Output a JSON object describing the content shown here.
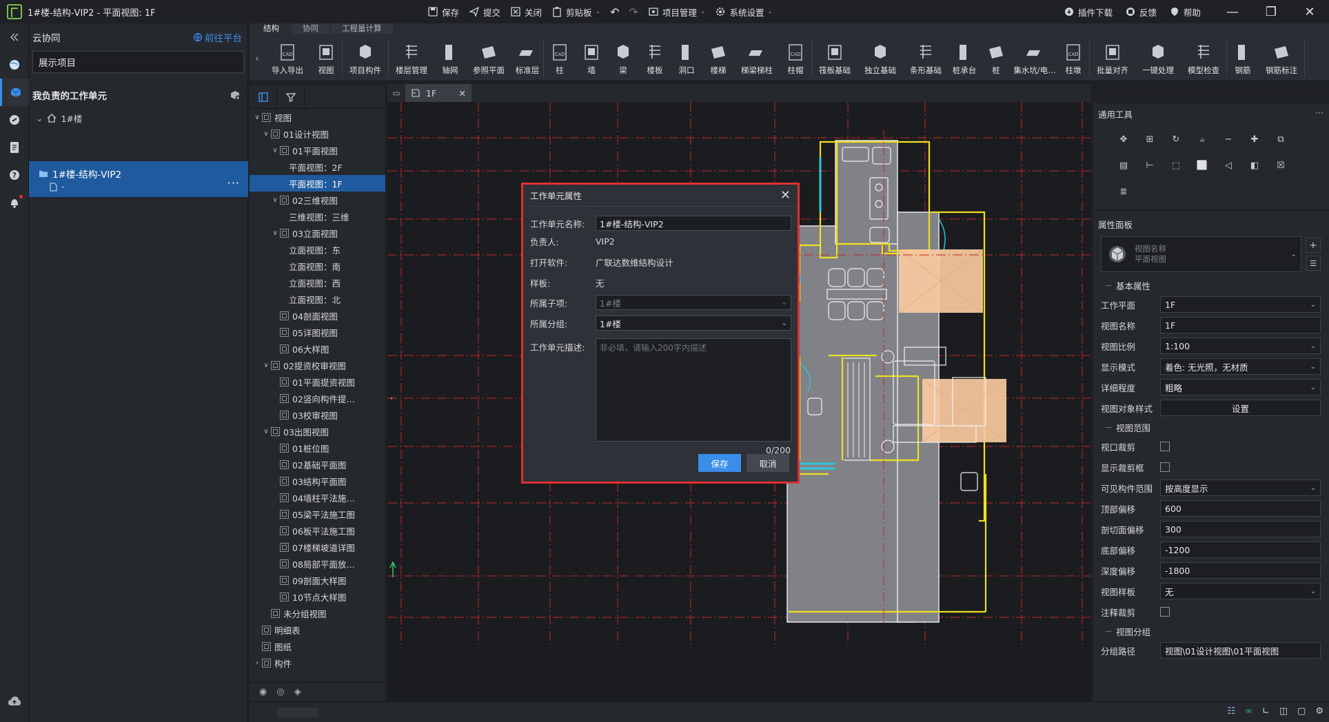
{
  "window": {
    "title": "1#楼-结构-VIP2 - 平面视图: 1F",
    "center_actions": [
      {
        "label": "保存",
        "icon": "save-icon"
      },
      {
        "label": "提交",
        "icon": "submit-icon"
      },
      {
        "label": "关闭",
        "icon": "close-doc-icon"
      },
      {
        "label": "剪贴板",
        "icon": "clipboard-icon"
      },
      {
        "label": "项目管理",
        "icon": "project-manage-icon"
      },
      {
        "label": "系统设置",
        "icon": "gear-icon"
      }
    ],
    "right_actions": [
      {
        "label": "插件下载",
        "icon": "plugin-icon"
      },
      {
        "label": "反馈",
        "icon": "feedback-icon"
      },
      {
        "label": "帮助",
        "icon": "help-icon"
      }
    ]
  },
  "left_panel": {
    "title": "云协同",
    "goto_platform": "前往平台",
    "project": "展示项目",
    "section_title": "我负责的工作单元",
    "building": "1#楼",
    "selected_unit": {
      "name": "1#楼-结构-VIP2",
      "sub": "-"
    }
  },
  "ribbon": {
    "tabs": [
      "结构",
      "协同",
      "工程量计算"
    ],
    "tools": [
      [
        "导入导出",
        "视图"
      ],
      [
        "项目构件"
      ],
      [
        "楼层管理",
        "轴网",
        "参照平面",
        "标准层"
      ],
      [
        "柱",
        "墙",
        "梁",
        "楼板",
        "洞口",
        "楼梯",
        "梯梁梯柱",
        "柱帽"
      ],
      [
        "筏板基础",
        "独立基础",
        "条形基础",
        "桩承台",
        "桩",
        "集水坑/电…",
        "柱墩"
      ],
      [
        "批量对齐",
        "一键处理",
        "模型检查"
      ],
      [
        "钢筋",
        "钢筋标注"
      ]
    ]
  },
  "tree": {
    "items": [
      {
        "label": "视图",
        "level": 0,
        "exp": "v"
      },
      {
        "label": "01设计视图",
        "level": 1,
        "exp": "v"
      },
      {
        "label": "01平面视图",
        "level": 2,
        "exp": "v"
      },
      {
        "label": "平面视图：2F",
        "level": 3,
        "exp": "",
        "nobox": true
      },
      {
        "label": "平面视图：1F",
        "level": 3,
        "exp": "",
        "nobox": true,
        "sel": true
      },
      {
        "label": "02三维视图",
        "level": 2,
        "exp": "v"
      },
      {
        "label": "三维视图：三维",
        "level": 3,
        "exp": "",
        "nobox": true
      },
      {
        "label": "03立面视图",
        "level": 2,
        "exp": "v"
      },
      {
        "label": "立面视图：东",
        "level": 3,
        "exp": "",
        "nobox": true
      },
      {
        "label": "立面视图：南",
        "level": 3,
        "exp": "",
        "nobox": true
      },
      {
        "label": "立面视图：西",
        "level": 3,
        "exp": "",
        "nobox": true
      },
      {
        "label": "立面视图：北",
        "level": 3,
        "exp": "",
        "nobox": true
      },
      {
        "label": "04剖面视图",
        "level": 2,
        "exp": ""
      },
      {
        "label": "05详图视图",
        "level": 2,
        "exp": ""
      },
      {
        "label": "06大样图",
        "level": 2,
        "exp": ""
      },
      {
        "label": "02提资校审视图",
        "level": 1,
        "exp": "v"
      },
      {
        "label": "01平面提资视图",
        "level": 2,
        "exp": ""
      },
      {
        "label": "02竖向构件提…",
        "level": 2,
        "exp": ""
      },
      {
        "label": "03校审视图",
        "level": 2,
        "exp": ""
      },
      {
        "label": "03出图视图",
        "level": 1,
        "exp": "v"
      },
      {
        "label": "01桩位图",
        "level": 2,
        "exp": ""
      },
      {
        "label": "02基础平面图",
        "level": 2,
        "exp": ""
      },
      {
        "label": "03结构平面图",
        "level": 2,
        "exp": ""
      },
      {
        "label": "04墙柱平法施…",
        "level": 2,
        "exp": ""
      },
      {
        "label": "05梁平法施工图",
        "level": 2,
        "exp": ""
      },
      {
        "label": "06板平法施工图",
        "level": 2,
        "exp": ""
      },
      {
        "label": "07楼梯坡道详图",
        "level": 2,
        "exp": ""
      },
      {
        "label": "08局部平面放…",
        "level": 2,
        "exp": ""
      },
      {
        "label": "09剖面大样图",
        "level": 2,
        "exp": ""
      },
      {
        "label": "10节点大样图",
        "level": 2,
        "exp": ""
      },
      {
        "label": "未分组视图",
        "level": 1,
        "exp": ""
      },
      {
        "label": "明细表",
        "level": 0,
        "exp": ""
      },
      {
        "label": "图纸",
        "level": 0,
        "exp": ""
      },
      {
        "label": "构件",
        "level": 0,
        "exp": ">"
      }
    ]
  },
  "canvas": {
    "tab": "1F"
  },
  "dialog": {
    "title": "工作单元属性",
    "fields": {
      "name_label": "工作单元名称:",
      "name_value": "1#楼-结构-VIP2",
      "owner_label": "负责人:",
      "owner_value": "VIP2",
      "software_label": "打开软件:",
      "software_value": "广联达数维结构设计",
      "template_label": "样板:",
      "template_value": "无",
      "subitem_label": "所属子项:",
      "subitem_value": "1#楼",
      "group_label": "所属分组:",
      "group_value": "1#楼",
      "desc_label": "工作单元描述:",
      "desc_placeholder": "非必填，请输入200字内描述",
      "counter": "0/200"
    },
    "save": "保存",
    "cancel": "取消"
  },
  "props": {
    "tools_title": "通用工具",
    "panel_title": "属性面板",
    "type_selector": {
      "line1": "视图名称",
      "line2": "平面视图"
    },
    "basic": "基本属性",
    "rows1": [
      {
        "label": "工作平面",
        "value": "1F",
        "type": "select"
      },
      {
        "label": "视图名称",
        "value": "1F",
        "type": "text"
      },
      {
        "label": "视图比例",
        "value": "1:100",
        "type": "select"
      },
      {
        "label": "显示模式",
        "value": "着色: 无光照，无材质",
        "type": "select"
      },
      {
        "label": "详细程度",
        "value": "粗略",
        "type": "select"
      },
      {
        "label": "视图对象样式",
        "value": "设置",
        "type": "button"
      }
    ],
    "range": "视图范围",
    "rows2": [
      {
        "label": "视口裁剪",
        "type": "check"
      },
      {
        "label": "显示裁剪框",
        "type": "check"
      },
      {
        "label": "可见构件范围",
        "value": "按高度显示",
        "type": "select"
      },
      {
        "label": "顶部偏移",
        "value": "600",
        "type": "text"
      },
      {
        "label": "剖切面偏移",
        "value": "300",
        "type": "text"
      },
      {
        "label": "底部偏移",
        "value": "-1200",
        "type": "text"
      },
      {
        "label": "深度偏移",
        "value": "-1800",
        "type": "text"
      },
      {
        "label": "视图样板",
        "value": "无",
        "type": "select"
      },
      {
        "label": "注释裁剪",
        "type": "check"
      }
    ],
    "group": "视图分组",
    "group_row": {
      "label": "分组路径",
      "value": "视图\\01设计视图\\01平面视图"
    }
  }
}
